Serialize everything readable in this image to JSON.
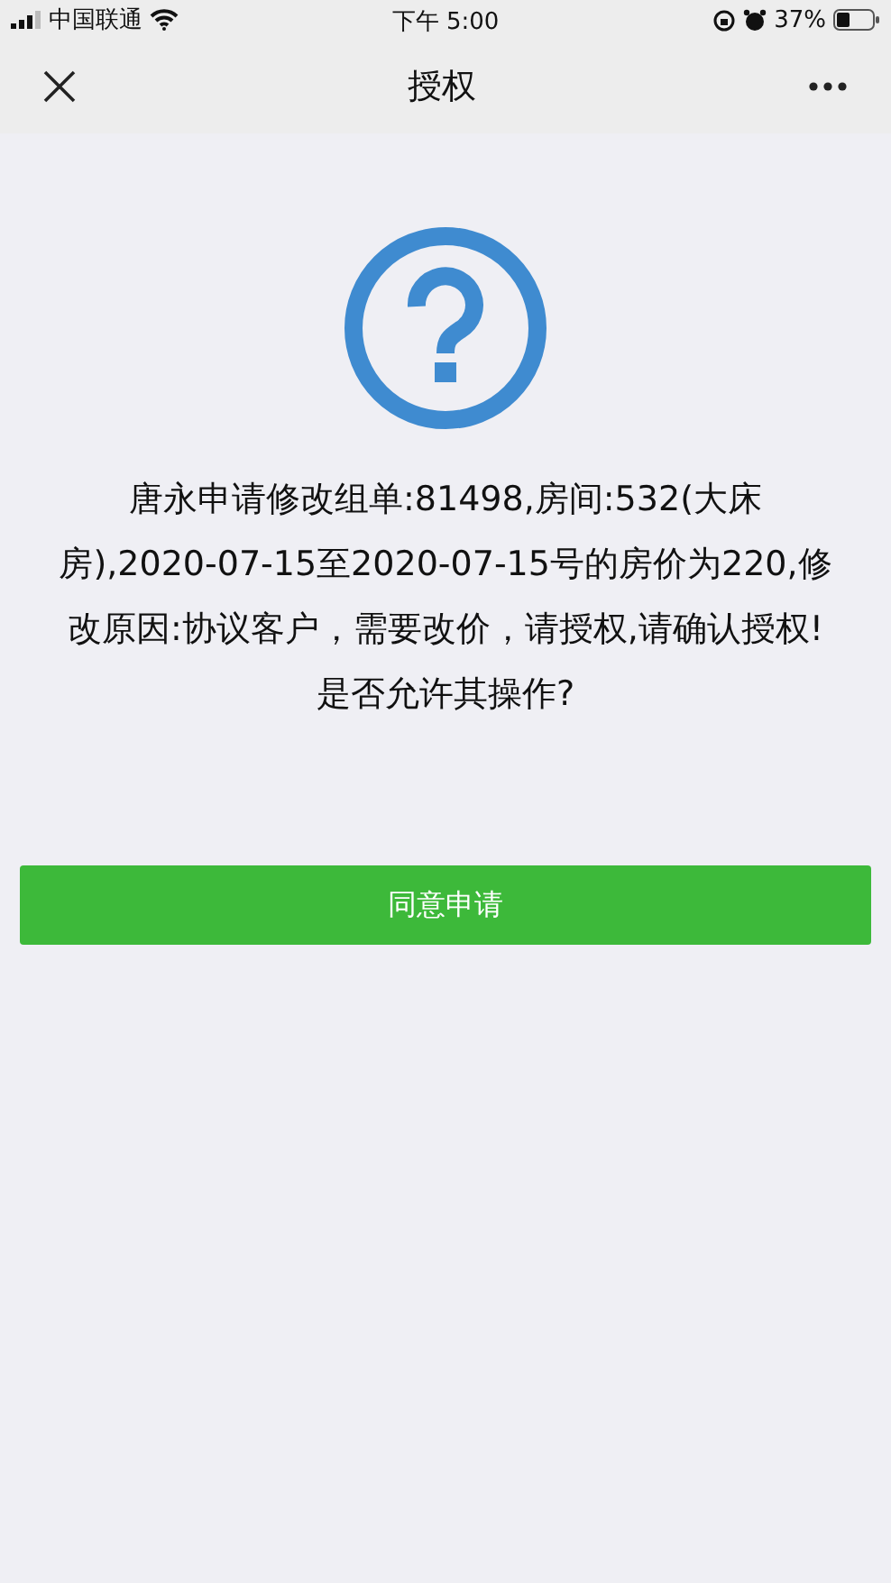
{
  "status_bar": {
    "carrier": "中国联通",
    "time": "下午 5:00",
    "battery": "37%"
  },
  "nav_bar": {
    "title": "授权"
  },
  "message": "唐永申请修改组单:81498,房间:532(大床房),2020-07-15至2020-07-15号的房价为220,修改原因:协议客户，需要改价，请授权,请确认授权!",
  "question": "是否允许其操作?",
  "button": "同意申请"
}
